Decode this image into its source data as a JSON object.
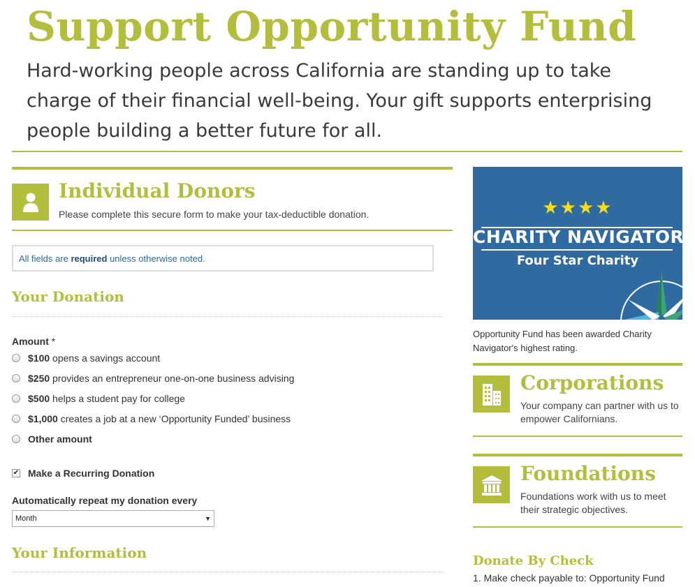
{
  "hero": {
    "title": "Support Opportunity Fund",
    "text": "Hard-working people across California are standing up to take charge of their financial well-being. Your gift supports enterprising people building a better future for all."
  },
  "donor": {
    "icon": "person-icon",
    "title": "Individual Donors",
    "subtitle": "Please complete this secure form to make your tax-deductible donation."
  },
  "notice": {
    "prefix": "All fields are",
    "emphasis": "required",
    "suffix": "unless otherwise noted."
  },
  "donation": {
    "section_title": "Your Donation",
    "amount_label": "Amount",
    "required_mark": "*",
    "options": [
      {
        "amount": "$100",
        "desc": "opens a savings account",
        "selected": false
      },
      {
        "amount": "$250",
        "desc": "provides an entrepreneur one-on-one business advising",
        "selected": false
      },
      {
        "amount": "$500",
        "desc": "helps a student pay for college",
        "selected": false
      },
      {
        "amount": "$1,000",
        "desc": "creates a job at a new ‘Opportunity Funded’ business",
        "selected": false
      },
      {
        "amount": "Other amount",
        "desc": "",
        "selected": false
      }
    ],
    "recurring_label": "Make a Recurring Donation",
    "recurring_checked": true,
    "repeat_label": "Automatically repeat my donation every",
    "repeat_value": "Month"
  },
  "information": {
    "section_title": "Your Information"
  },
  "badge": {
    "stars": "★★★★",
    "name": "CHARITY NAVIGATOR",
    "rating": "Four Star Charity",
    "caption": "Opportunity Fund has been awarded Charity Navigator's highest rating.",
    "colors": {
      "background": "#2f6aa1",
      "stars": "#f6dd1a"
    }
  },
  "corporations": {
    "icon": "building-icon",
    "title": "Corporations",
    "text": "Your company can partner with us to empower Californians."
  },
  "foundations": {
    "icon": "institution-icon",
    "title": "Foundations",
    "text": "Foundations work with us to meet their strategic objectives."
  },
  "check": {
    "title": "Donate By Check",
    "step1": "1. Make check payable to: Opportunity Fund"
  },
  "theme": {
    "accent": "#b3be3c"
  }
}
